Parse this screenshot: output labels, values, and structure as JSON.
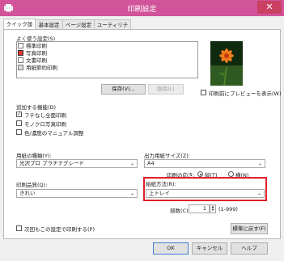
{
  "window": {
    "title": "印刷設定",
    "close_label": "✕"
  },
  "tabs": [
    {
      "label": "クイック設定"
    },
    {
      "label": "基本設定"
    },
    {
      "label": "ページ設定"
    },
    {
      "label": "ユーティリティ"
    }
  ],
  "presets": {
    "label": "よく使う設定(S)",
    "items": [
      {
        "label": "標準印刷"
      },
      {
        "label": "写真印刷"
      },
      {
        "label": "文書印刷"
      },
      {
        "label": "用紙節約印刷"
      }
    ],
    "save_label": "保存(V)...",
    "delete_label": "削除(L)"
  },
  "preview": {
    "show_preview_label": "印刷前にプレビューを表示(W)",
    "checked": false
  },
  "features": {
    "label": "追加する機能(D)",
    "items": [
      {
        "label": "フチなし全面印刷",
        "checked": true
      },
      {
        "label": "モノクロ写真印刷",
        "checked": false
      },
      {
        "label": "色/濃度のマニュアル調整",
        "checked": false
      }
    ]
  },
  "media": {
    "label": "用紙の種類(Y):",
    "value": "光沢プロ プラチナグレード"
  },
  "output_size": {
    "label": "出力用紙サイズ(Z):",
    "value": "A4"
  },
  "orientation": {
    "label": "印刷の向き:",
    "options": [
      {
        "label": "縦(T)",
        "selected": true
      },
      {
        "label": "横(N)",
        "selected": false
      }
    ]
  },
  "quality": {
    "label": "印刷品質(Q):",
    "value": "きれい"
  },
  "paper_source": {
    "label": "給紙方法(R):",
    "value": "上トレイ"
  },
  "copies": {
    "label": "部数(C):",
    "value": "1",
    "range": "(1-999)"
  },
  "always_print": {
    "label": "次回もこの設定で印刷する(P)",
    "checked": false
  },
  "buttons": {
    "defaults": "標準に戻す(F)",
    "ok": "OK",
    "cancel": "キャンセル",
    "help": "ヘルプ"
  },
  "colors": {
    "titlebar": "#d1549a",
    "close": "#c94062",
    "highlight": "#e0202a"
  }
}
